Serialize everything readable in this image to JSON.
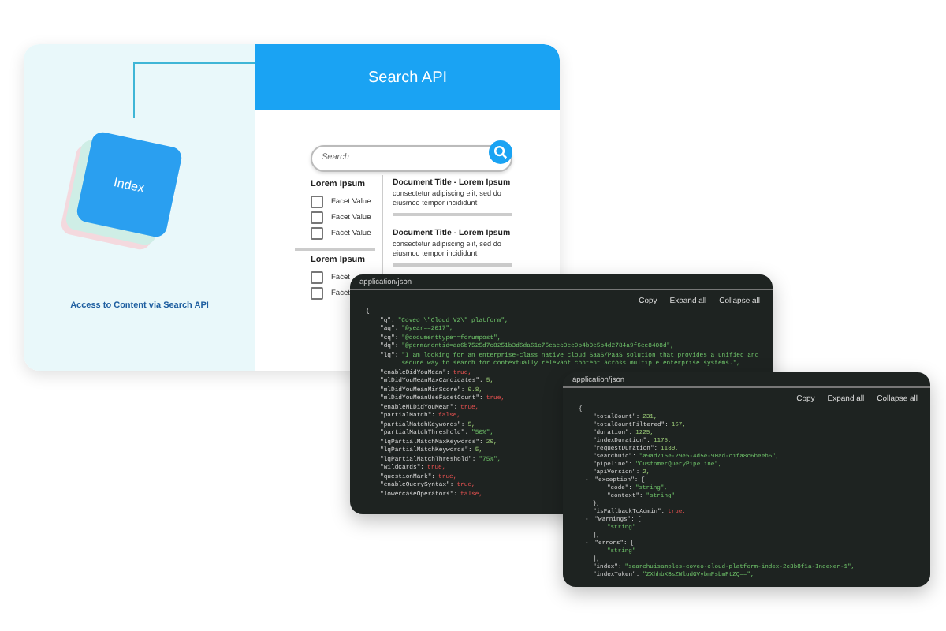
{
  "index_panel": {
    "tile_label": "Index",
    "caption": "Access to Content via Search API"
  },
  "search_ui": {
    "title": "Search API",
    "search": {
      "placeholder": "Search"
    },
    "facet_groups": [
      {
        "title": "Lorem Ipsum",
        "facets": [
          {
            "label": "Facet Value",
            "checked": false
          },
          {
            "label": "Facet Value",
            "checked": false
          },
          {
            "label": "Facet Value",
            "checked": false
          }
        ]
      },
      {
        "title": "Lorem Ipsum",
        "facets": [
          {
            "label": "Facet",
            "checked": false
          },
          {
            "label": "Facet",
            "checked": false
          }
        ]
      }
    ],
    "documents": [
      {
        "title": "Document Title - Lorem Ipsum",
        "excerpt": "consectetur adipiscing elit, sed do eiusmod tempor incididunt"
      },
      {
        "title": "Document Title - Lorem Ipsum",
        "excerpt": "consectetur adipiscing elit, sed do eiusmod tempor incididunt"
      }
    ]
  },
  "json_panels": [
    {
      "content_type": "application/json",
      "actions": [
        "Copy",
        "Expand all",
        "Collapse all"
      ],
      "open": "{",
      "entries": [
        {
          "key": "\"q\":",
          "value": "\"Coveo \\\"Cloud V2\\\" platform\",",
          "kind": "string"
        },
        {
          "key": "\"aq\":",
          "value": "\"@year==2017\",",
          "kind": "string"
        },
        {
          "key": "\"cq\":",
          "value": "\"@documenttype==forumpost\",",
          "kind": "string"
        },
        {
          "key": "\"dq\":",
          "value": "\"@permanentid=aa6b7525d7c8251b3d6da61c75eaec0ee9b4b0e5b4d2784a9f6ee8408d\",",
          "kind": "string"
        },
        {
          "key": "\"lq\":",
          "value": "\"I am looking for an enterprise-class native cloud SaaS/PaaS solution that provides a unified and secure way to search for contextually relevant content across multiple enterprise systems.\",",
          "kind": "string"
        },
        {
          "key": "\"enableDidYouMean\":",
          "value": "true,",
          "kind": "boolean"
        },
        {
          "key": "\"mlDidYouMeanMaxCandidates\":",
          "value": "5,",
          "kind": "number"
        },
        {
          "key": "\"mlDidYouMeanMinScore\":",
          "value": "0.8,",
          "kind": "number"
        },
        {
          "key": "\"mlDidYouMeanUseFacetCount\":",
          "value": "true,",
          "kind": "boolean"
        },
        {
          "key": "\"enableMLDidYouMean\":",
          "value": "true,",
          "kind": "boolean"
        },
        {
          "key": "\"partialMatch\":",
          "value": "false,",
          "kind": "boolean"
        },
        {
          "key": "\"partialMatchKeywords\":",
          "value": "5,",
          "kind": "number"
        },
        {
          "key": "\"partialMatchThreshold\":",
          "value": "\"50%\",",
          "kind": "string"
        },
        {
          "key": "\"lqPartialMatchMaxKeywords\":",
          "value": "20,",
          "kind": "number"
        },
        {
          "key": "\"lqPartialMatchKeywords\":",
          "value": "5,",
          "kind": "number"
        },
        {
          "key": "\"lqPartialMatchThreshold\":",
          "value": "\"75%\",",
          "kind": "string"
        },
        {
          "key": "\"wildcards\":",
          "value": "true,",
          "kind": "boolean"
        },
        {
          "key": "\"questionMark\":",
          "value": "true,",
          "kind": "boolean"
        },
        {
          "key": "\"enableQuerySyntax\":",
          "value": "true,",
          "kind": "boolean"
        },
        {
          "key": "\"lowercaseOperators\":",
          "value": "false,",
          "kind": "boolean"
        }
      ]
    },
    {
      "content_type": "application/json",
      "actions": [
        "Copy",
        "Expand all",
        "Collapse all"
      ],
      "open": "{",
      "entries": [
        {
          "key": "\"totalCount\":",
          "value": "231,",
          "kind": "number"
        },
        {
          "key": "\"totalCountFiltered\":",
          "value": "167,",
          "kind": "number"
        },
        {
          "key": "\"duration\":",
          "value": "1225,",
          "kind": "number"
        },
        {
          "key": "\"indexDuration\":",
          "value": "1175,",
          "kind": "number"
        },
        {
          "key": "\"requestDuration\":",
          "value": "1180,",
          "kind": "number"
        },
        {
          "key": "\"searchUid\":",
          "value": "\"a9ad715e-29e5-4d5e-90ad-c1fa8c6beeb6\",",
          "kind": "string"
        },
        {
          "key": "\"pipeline\":",
          "value": "\"CustomerQueryPipeline\",",
          "kind": "string"
        },
        {
          "key": "\"apiVersion\":",
          "value": "2,",
          "kind": "number"
        },
        {
          "key": "\"exception\":",
          "toggle": "-",
          "open": "{",
          "close": "},",
          "children": [
            {
              "key": "\"code\":",
              "value": "\"string\",",
              "kind": "string"
            },
            {
              "key": "\"context\":",
              "value": "\"string\"",
              "kind": "string"
            }
          ]
        },
        {
          "key": "\"isFallbackToAdmin\":",
          "value": "true,",
          "kind": "boolean"
        },
        {
          "key": "\"warnings\":",
          "toggle": "-",
          "open": "[",
          "close": "],",
          "children": [
            {
              "value": "\"string\"",
              "kind": "string"
            }
          ]
        },
        {
          "key": "\"errors\":",
          "toggle": "-",
          "open": "[",
          "close": "],",
          "children": [
            {
              "value": "\"string\"",
              "kind": "string"
            }
          ]
        },
        {
          "key": "\"index\":",
          "value": "\"searchuisamples-coveo-cloud-platform-index-2c3b8f1a-Indexer-1\",",
          "kind": "string"
        },
        {
          "key": "\"indexToken\":",
          "value": "\"ZXhhbXBsZWludGVybmFsbmFtZQ==\",",
          "kind": "string"
        }
      ]
    }
  ]
}
